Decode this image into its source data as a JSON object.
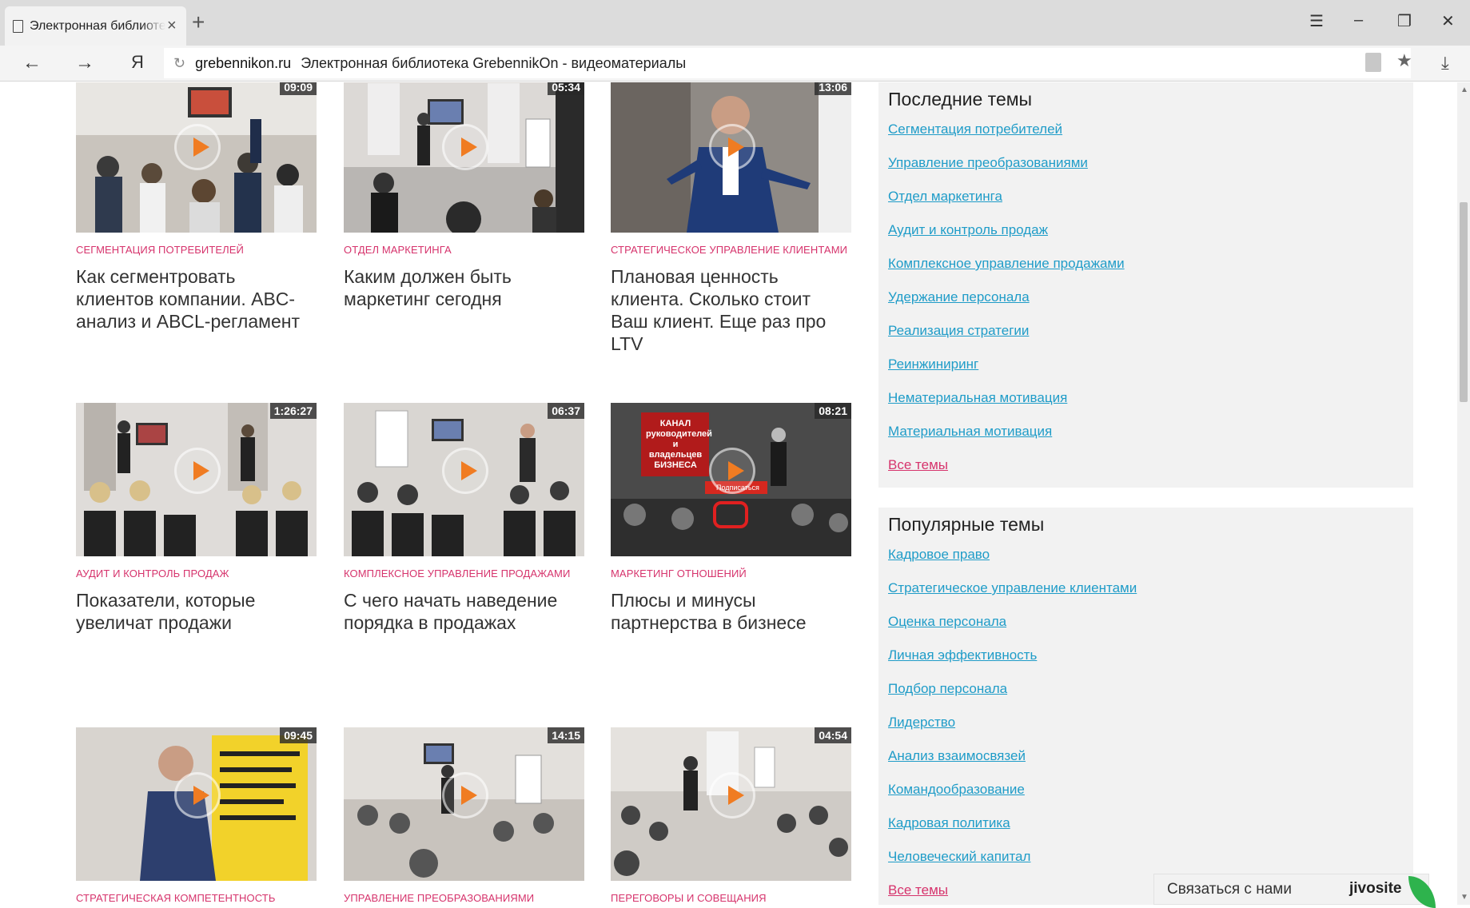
{
  "browser": {
    "tab_title": "Электронная библиотека GrebennikOn",
    "tab_close": "×",
    "new_tab": "+",
    "url_host": "grebennikon.ru",
    "page_title": "Электронная библиотека GrebennikOn - видеоматериалы",
    "yandex_logo": "Я"
  },
  "videos": [
    {
      "duration": "09:09",
      "category": "Сегментация потребителей",
      "title": "Как сегментровать клиентов компании. ABC-анализ и ABCL-регламент"
    },
    {
      "duration": "05:34",
      "category": "Отдел маркетинга",
      "title": "Каким должен быть маркетинг сегодня"
    },
    {
      "duration": "13:06",
      "category": "Стратегическое управление клиентами",
      "title": "Плановая ценность клиента. Сколько стоит Ваш клиент. Еще раз про LTV"
    },
    {
      "duration": "1:26:27",
      "category": "Аудит и контроль продаж",
      "title": "Показатели, которые увеличат продажи"
    },
    {
      "duration": "06:37",
      "category": "Комплексное управление продажами",
      "title": "С чего начать наведение порядка в продажах"
    },
    {
      "duration": "08:21",
      "category": "Маркетинг отношений",
      "title": "Плюсы и минусы партнерства в бизнесе",
      "overlay": "КАНАЛ руководителей и владельцев БИЗНЕСА",
      "subscribe": "Подписаться"
    },
    {
      "duration": "09:45",
      "category": "Стратегическая компетентность",
      "title": ""
    },
    {
      "duration": "14:15",
      "category": "Управление преобразованиями",
      "title": ""
    },
    {
      "duration": "04:54",
      "category": "Переговоры и совещания",
      "title": ""
    }
  ],
  "sidebar": {
    "recent": {
      "heading": "Последние темы",
      "links": [
        "Сегментация потребителей",
        "Управление преобразованиями",
        "Отдел маркетинга",
        "Аудит и контроль продаж",
        "Комплексное управление продажами",
        "Удержание персонала",
        "Реализация стратегии",
        "Реинжиниринг",
        "Нематериальная мотивация",
        "Материальная мотивация"
      ],
      "all": "Все темы"
    },
    "popular": {
      "heading": "Популярные темы",
      "links": [
        "Кадровое право",
        "Стратегическое управление клиентами",
        "Оценка персонала",
        "Личная эффективность",
        "Подбор персонала",
        "Лидерство",
        "Анализ взаимосвязей",
        "Командообразование",
        "Кадровая политика",
        "Человеческий капитал"
      ],
      "all": "Все темы"
    }
  },
  "chat": {
    "label": "Связаться с нами",
    "brand": "jivosite"
  },
  "colors": {
    "category": "#d6336c",
    "link": "#1f9cc8",
    "play": "#f07c22",
    "sidebar_bg": "#f2f2f2"
  }
}
